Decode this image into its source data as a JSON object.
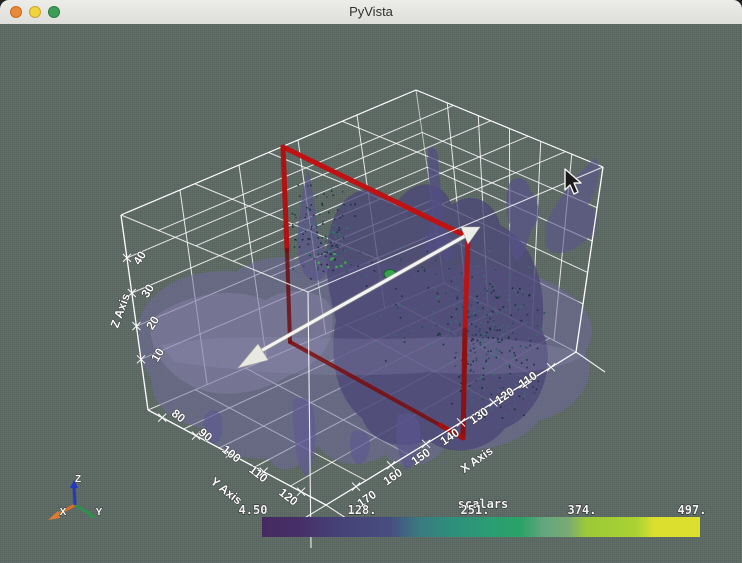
{
  "window": {
    "title": "PyVista",
    "controls": {
      "close": "close",
      "minimize": "minimize",
      "zoom": "zoom"
    },
    "traffic_colors": {
      "close": "#e8883a",
      "minimize": "#eed53c",
      "zoom": "#3f9e56"
    }
  },
  "viewport": {
    "background_color": "#5e6a64",
    "outline_color": "#ffffff",
    "volume_color": "#5a5588"
  },
  "axes": {
    "x": {
      "title": "X Axis",
      "ticks": [
        "170",
        "160",
        "150",
        "140",
        "130",
        "120",
        "110"
      ]
    },
    "y": {
      "title": "Y Axis",
      "ticks": [
        "80",
        "90",
        "100",
        "110",
        "120"
      ]
    },
    "z": {
      "title": "Z Axis",
      "ticks": [
        "10",
        "20",
        "30",
        "40"
      ]
    }
  },
  "colorbar": {
    "title": "scalars",
    "tick_labels": [
      "4.50",
      "128.",
      "251.",
      "374.",
      "497."
    ],
    "range": [
      4.5,
      497
    ],
    "colormap": "viridis",
    "colors": [
      "#452a5e",
      "#454177",
      "#474d80",
      "#2f8c7c",
      "#2aa266",
      "#63a67f",
      "#9cc938",
      "#dcdf2e"
    ]
  },
  "plane_widget": {
    "outline_color": "#b41212",
    "arrow_color": "#f2f2ee",
    "origin_handle_color": "#36a14e"
  },
  "orientation_marker": {
    "x_label": "X",
    "y_label": "Y",
    "z_label": "Z",
    "x_color": "#d96f2a",
    "y_color": "#2f8f4e",
    "z_color": "#2438c8"
  },
  "cursor": {
    "type": "arrow-pointer"
  }
}
